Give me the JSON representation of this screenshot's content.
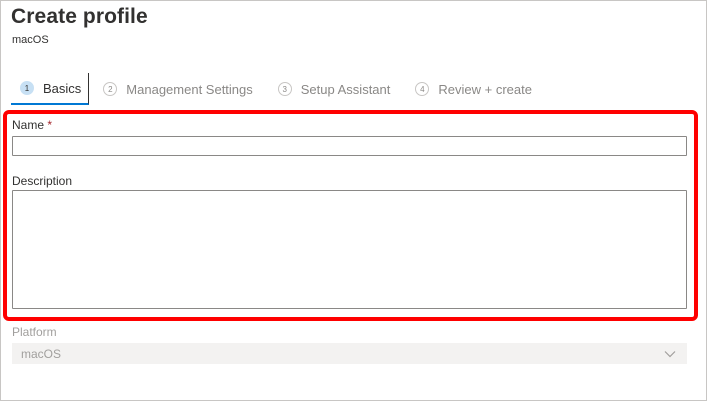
{
  "page": {
    "title": "Create profile",
    "subtitle": "macOS"
  },
  "steps": [
    {
      "number": "1",
      "label": "Basics",
      "active": true
    },
    {
      "number": "2",
      "label": "Management Settings",
      "active": false
    },
    {
      "number": "3",
      "label": "Setup Assistant",
      "active": false
    },
    {
      "number": "4",
      "label": "Review + create",
      "active": false
    }
  ],
  "form": {
    "name": {
      "label": "Name",
      "required_mark": "*",
      "value": ""
    },
    "description": {
      "label": "Description",
      "value": ""
    },
    "platform": {
      "label": "Platform",
      "value": "macOS",
      "disabled": true
    }
  },
  "colors": {
    "accent": "#0078d4",
    "highlight_border": "#ff0000",
    "required": "#a4262c",
    "disabled_text": "#a19f9d",
    "disabled_bg": "#f3f2f1"
  },
  "icons": {
    "dropdown": "chevron-down-icon"
  }
}
